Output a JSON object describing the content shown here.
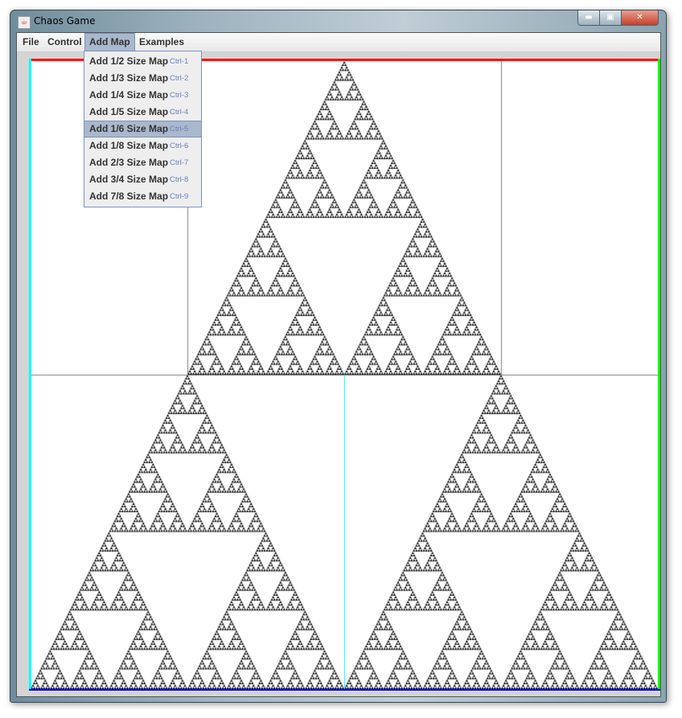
{
  "window": {
    "title": "Chaos Game",
    "icon": "java-cup-icon",
    "controls": [
      "minimize",
      "maximize",
      "close"
    ]
  },
  "menubar": {
    "items": [
      {
        "label": "File"
      },
      {
        "label": "Control"
      },
      {
        "label": "Add Map",
        "active": true
      },
      {
        "label": "Examples"
      }
    ]
  },
  "dropdown": {
    "items": [
      {
        "label": "Add 1/2 Size Map",
        "shortcut": "Ctrl-1"
      },
      {
        "label": "Add 1/3 Size Map",
        "shortcut": "Ctrl-2"
      },
      {
        "label": "Add 1/4 Size Map",
        "shortcut": "Ctrl-3"
      },
      {
        "label": "Add 1/5 Size Map",
        "shortcut": "Ctrl-4"
      },
      {
        "label": "Add 1/6 Size Map",
        "shortcut": "Ctrl-5",
        "highlighted": true
      },
      {
        "label": "Add 1/8 Size Map",
        "shortcut": "Ctrl-6"
      },
      {
        "label": "Add 2/3 Size Map",
        "shortcut": "Ctrl-7"
      },
      {
        "label": "Add 3/4 Size Map",
        "shortcut": "Ctrl-8"
      },
      {
        "label": "Add 7/8 Size Map",
        "shortcut": "Ctrl-9"
      }
    ]
  },
  "canvas": {
    "fractal": "sierpinski-triangle",
    "border_colors": {
      "top": "#ff0000",
      "left": "#00ffff",
      "right": "#00ff00",
      "bottom": "#0000ff"
    },
    "map_outline_color": "#808080",
    "highlight_line_color": "#00ffff"
  }
}
